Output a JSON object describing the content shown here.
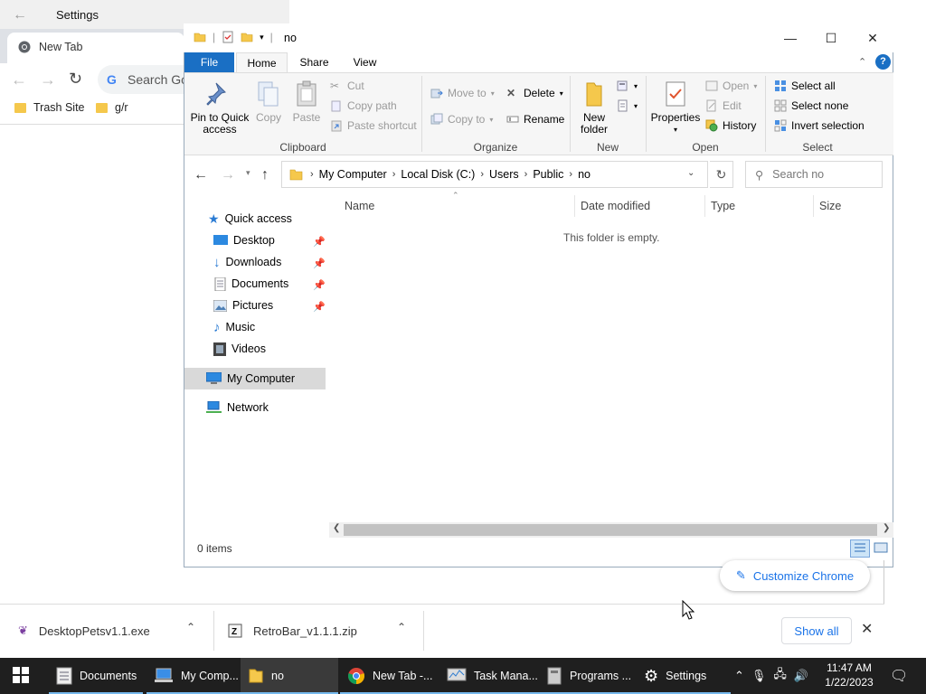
{
  "settings": {
    "title": "Settings"
  },
  "chrome": {
    "tab_title": "New Tab",
    "search_text": "Search Go",
    "bookmarks": [
      "Trash Site",
      "g/r"
    ],
    "customize_label": "Customize Chrome"
  },
  "explorer": {
    "title": "no",
    "ribbon_tabs": {
      "file": "File",
      "home": "Home",
      "share": "Share",
      "view": "View"
    },
    "clipboard": {
      "label": "Clipboard",
      "pin": "Pin to Quick access",
      "copy": "Copy",
      "paste": "Paste",
      "cut": "Cut",
      "copy_path": "Copy path",
      "paste_shortcut": "Paste shortcut"
    },
    "organize": {
      "label": "Organize",
      "move_to": "Move to",
      "copy_to": "Copy to",
      "delete": "Delete",
      "rename": "Rename"
    },
    "new": {
      "label": "New",
      "new_folder": "New folder"
    },
    "open": {
      "label": "Open",
      "properties": "Properties",
      "open": "Open",
      "edit": "Edit",
      "history": "History"
    },
    "select": {
      "label": "Select",
      "select_all": "Select all",
      "select_none": "Select none",
      "invert": "Invert selection"
    },
    "breadcrumb": [
      "My Computer",
      "Local Disk (C:)",
      "Users",
      "Public",
      "no"
    ],
    "search_placeholder": "Search no",
    "nav": {
      "quick_access": "Quick access",
      "items": [
        "Desktop",
        "Downloads",
        "Documents",
        "Pictures",
        "Music",
        "Videos"
      ],
      "my_computer": "My Computer",
      "network": "Network"
    },
    "columns": [
      "Name",
      "Date modified",
      "Type",
      "Size"
    ],
    "empty_message": "This folder is empty.",
    "status": "0 items"
  },
  "downloads": {
    "items": [
      "DesktopPetsv1.1.exe",
      "RetroBar_v1.1.1.zip"
    ],
    "show_all": "Show all"
  },
  "taskbar": {
    "items": [
      "Documents",
      "My Comp...",
      "no",
      "New Tab -...",
      "Task Mana...",
      "Programs ...",
      "Settings"
    ],
    "time": "11:47 AM",
    "date": "1/22/2023"
  },
  "colors": {
    "accent": "#1a6fc4",
    "chrome_blue": "#1a73e8",
    "taskbar": "#1f1f1f"
  }
}
